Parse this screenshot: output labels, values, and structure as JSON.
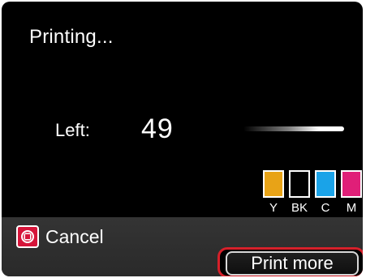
{
  "status": {
    "title": "Printing..."
  },
  "remaining": {
    "label": "Left:",
    "value": "49"
  },
  "progress": {
    "fraction": 0.62
  },
  "inks": [
    {
      "label": "Y",
      "color": "#e8a317",
      "level": 1.0
    },
    {
      "label": "BK",
      "color": "#000000",
      "level": 0.0
    },
    {
      "label": "C",
      "color": "#1aa3e8",
      "level": 1.0
    },
    {
      "label": "M",
      "color": "#e01f78",
      "level": 1.0
    }
  ],
  "footer": {
    "cancel_label": "Cancel",
    "cancel_icon": "stop-icon",
    "print_more_label": "Print more",
    "highlight_color": "#d6202a"
  }
}
